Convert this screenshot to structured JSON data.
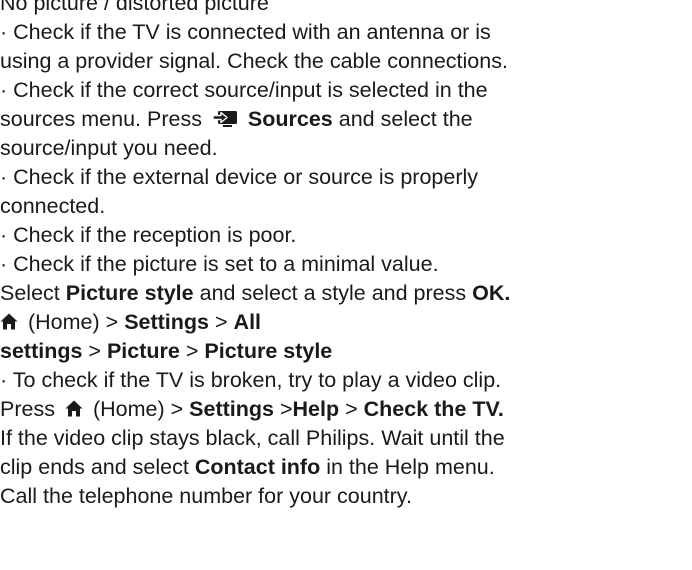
{
  "heading": "No picture / distorted picture",
  "bullet": "·",
  "check_antenna": {
    "line1": "Check if the TV is connected with an antenna or is",
    "line2": "using a provider signal. Check the cable connections."
  },
  "check_source": {
    "line1": "Check if the correct source/input is selected in the",
    "line2_pre": "sources menu. Press",
    "sources_label": "Sources",
    "line2_post": "and select the",
    "line3": "source/input you need."
  },
  "check_external": {
    "line1": "Check if the external device or source is properly",
    "line2": "connected."
  },
  "check_reception": "Check if the reception is poor.",
  "check_minimal": "Check if the picture is set to a minimal value.",
  "select_style": {
    "pre": "Select",
    "picture_style": "Picture style",
    "mid": "and select a style and press",
    "ok": "OK."
  },
  "path1": {
    "home": "(Home)",
    "sep": ">",
    "settings": "Settings",
    "all": "All",
    "settings_word": "settings",
    "picture": "Picture",
    "picture_style": "Picture style"
  },
  "check_broken": "To check if the TV is broken, try to play a video clip.",
  "press_line": {
    "press": "Press",
    "home": "(Home)",
    "sep": ">",
    "settings": "Settings",
    "help": "Help",
    "check_tv": "Check the TV."
  },
  "black_line": "If the video clip stays black, call Philips. Wait until the",
  "clip_line": {
    "pre": "clip ends and select",
    "contact": "Contact info",
    "post": "in the Help menu."
  },
  "call_line": "Call the telephone number for your country.",
  "icons": {
    "home": "home-icon",
    "sources": "sources-icon"
  },
  "colors": {
    "text": "#1a1a1a"
  }
}
